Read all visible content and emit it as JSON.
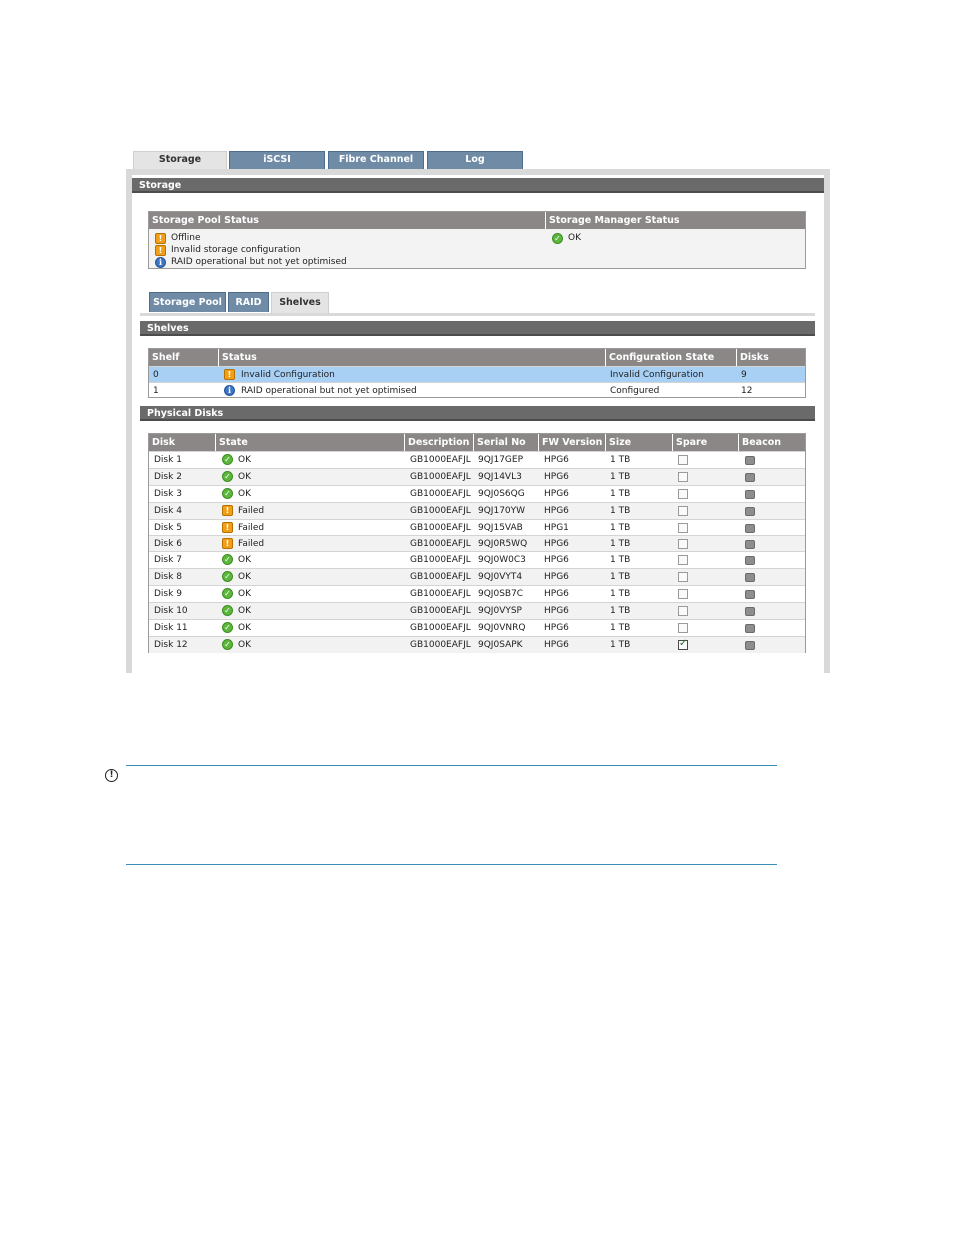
{
  "main_tabs": [
    "Storage",
    "iSCSI",
    "Fibre Channel",
    "Log"
  ],
  "storage_header": "Storage",
  "pool_status": {
    "col1": "Storage Pool Status",
    "col2": "Storage Manager Status",
    "items": [
      {
        "icon": "warning-icon",
        "text": "Offline"
      },
      {
        "icon": "warning-icon",
        "text": "Invalid storage configuration"
      },
      {
        "icon": "info-icon",
        "text": "RAID operational but not yet optimised"
      }
    ],
    "manager_status": "OK"
  },
  "sub_tabs": [
    "Storage Pool",
    "RAID",
    "Shelves"
  ],
  "shelves_header": "Shelves",
  "shelves_table": {
    "columns": [
      "Shelf",
      "Status",
      "Configuration State",
      "Disks"
    ],
    "rows": [
      {
        "shelf": "0",
        "icon": "warning-icon",
        "status": "Invalid Configuration",
        "config": "Invalid Configuration",
        "disks": "9"
      },
      {
        "shelf": "1",
        "icon": "info-icon",
        "status": "RAID operational but not yet optimised",
        "config": "Configured",
        "disks": "12"
      }
    ]
  },
  "disks_header": "Physical Disks",
  "disks_table": {
    "columns": [
      "Disk",
      "State",
      "Description",
      "Serial No",
      "FW Version",
      "Size",
      "Spare",
      "Beacon"
    ],
    "rows": [
      {
        "disk": "Disk 1",
        "state": "OK",
        "desc": "GB1000EAFJL",
        "serial": "9QJ17GEP",
        "fw": "HPG6",
        "size": "1 TB",
        "spare": false
      },
      {
        "disk": "Disk 2",
        "state": "OK",
        "desc": "GB1000EAFJL",
        "serial": "9QJ14VL3",
        "fw": "HPG6",
        "size": "1 TB",
        "spare": false
      },
      {
        "disk": "Disk 3",
        "state": "OK",
        "desc": "GB1000EAFJL",
        "serial": "9QJ0S6QG",
        "fw": "HPG6",
        "size": "1 TB",
        "spare": false
      },
      {
        "disk": "Disk 4",
        "state": "Failed",
        "desc": "GB1000EAFJL",
        "serial": "9QJ170YW",
        "fw": "HPG6",
        "size": "1 TB",
        "spare": false
      },
      {
        "disk": "Disk 5",
        "state": "Failed",
        "desc": "GB1000EAFJL",
        "serial": "9QJ15VAB",
        "fw": "HPG1",
        "size": "1 TB",
        "spare": false
      },
      {
        "disk": "Disk 6",
        "state": "Failed",
        "desc": "GB1000EAFJL",
        "serial": "9QJ0R5WQ",
        "fw": "HPG6",
        "size": "1 TB",
        "spare": false
      },
      {
        "disk": "Disk 7",
        "state": "OK",
        "desc": "GB1000EAFJL",
        "serial": "9QJ0W0C3",
        "fw": "HPG6",
        "size": "1 TB",
        "spare": false
      },
      {
        "disk": "Disk 8",
        "state": "OK",
        "desc": "GB1000EAFJL",
        "serial": "9QJ0VYT4",
        "fw": "HPG6",
        "size": "1 TB",
        "spare": false
      },
      {
        "disk": "Disk 9",
        "state": "OK",
        "desc": "GB1000EAFJL",
        "serial": "9QJ0SB7C",
        "fw": "HPG6",
        "size": "1 TB",
        "spare": false
      },
      {
        "disk": "Disk 10",
        "state": "OK",
        "desc": "GB1000EAFJL",
        "serial": "9QJ0VYSP",
        "fw": "HPG6",
        "size": "1 TB",
        "spare": false
      },
      {
        "disk": "Disk 11",
        "state": "OK",
        "desc": "GB1000EAFJL",
        "serial": "9QJ0VNRQ",
        "fw": "HPG6",
        "size": "1 TB",
        "spare": false
      },
      {
        "disk": "Disk 12",
        "state": "OK",
        "desc": "GB1000EAFJL",
        "serial": "9QJ0SAPK",
        "fw": "HPG6",
        "size": "1 TB",
        "spare": true
      }
    ]
  },
  "note_icon_glyph": "!",
  "colors": {
    "tab_blue": "#6f8ba6",
    "header_grey": "#8b8787",
    "section_dark": "#6a6a6a",
    "selected_row": "#a8d0f5",
    "warning": "#f0a018",
    "ok": "#5cb83c",
    "info": "#3d74c4"
  }
}
